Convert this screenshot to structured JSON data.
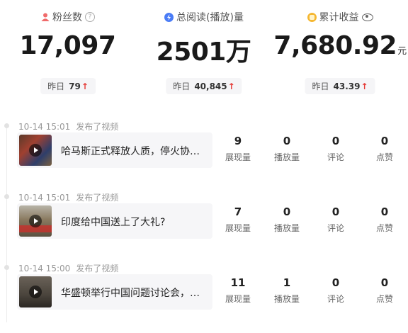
{
  "stats": [
    {
      "label": "粉丝数",
      "value": "17,097",
      "unit": "",
      "yesterday_label": "昨日",
      "yesterday_value": "79",
      "icon": "user-icon",
      "icon_color": "#f06b6b",
      "extra_icon": "help-icon"
    },
    {
      "label": "总阅读(播放)量",
      "value": "2501万",
      "unit": "",
      "yesterday_label": "昨日",
      "yesterday_value": "40,845",
      "icon": "lightning-icon",
      "icon_color": "#4a7cf6",
      "extra_icon": ""
    },
    {
      "label": "累计收益",
      "value": "7,680.92",
      "unit": "元",
      "yesterday_label": "昨日",
      "yesterday_value": "43.39",
      "icon": "coin-icon",
      "icon_color": "#f5b731",
      "extra_icon": "eye-icon"
    }
  ],
  "trend_up_symbol": "↑",
  "accent_red": "#e53935",
  "metric_labels": [
    "展现量",
    "播放量",
    "评论",
    "点赞"
  ],
  "entries": [
    {
      "time": "10-14 15:01",
      "action": "发布了视频",
      "title": "哈马斯正式释放人质，停火协议…",
      "metrics": [
        "9",
        "0",
        "0",
        "0"
      ]
    },
    {
      "time": "10-14 15:01",
      "action": "发布了视频",
      "title": "印度给中国送上了大礼?",
      "metrics": [
        "7",
        "0",
        "0",
        "0"
      ]
    },
    {
      "time": "10-14 15:00",
      "action": "发布了视频",
      "title": "华盛顿举行中国问题讨论会，…",
      "metrics": [
        "11",
        "1",
        "0",
        "0"
      ]
    }
  ]
}
